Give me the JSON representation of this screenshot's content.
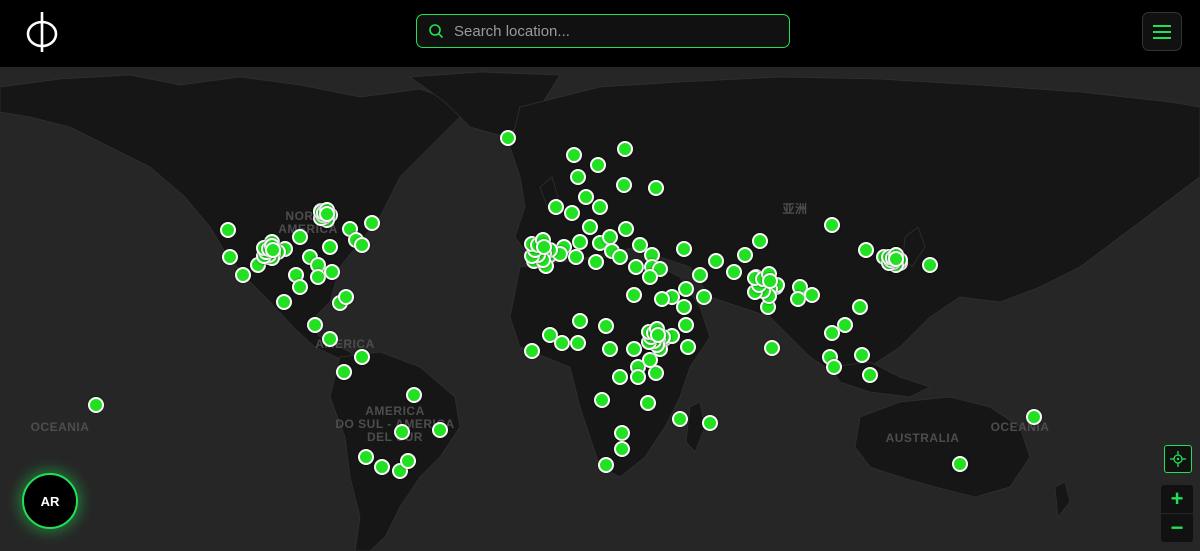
{
  "header": {
    "logo_glyph": "ϕ",
    "search": {
      "placeholder": "Search location...",
      "value": ""
    },
    "menu_icon": "hamburger-icon"
  },
  "map": {
    "labels": {
      "north_america": "NORTH\nAMERICA",
      "south_america": "AMERICA\nDO SUL - AMERICA\nDEL SUR",
      "asia": "亚洲",
      "australia": "AUSTRALIA",
      "oceania_left": "OCEANIA",
      "oceania_right": "OCEANIA",
      "central_america": "AMERICA"
    },
    "marker_color": "#22e022",
    "marker_count": "many"
  },
  "controls": {
    "ar_label": "AR",
    "locate_icon": "crosshair-icon",
    "zoom_in": "+",
    "zoom_out": "−"
  },
  "colors": {
    "accent": "#22e055",
    "land": "#161616",
    "water": "#262626"
  }
}
